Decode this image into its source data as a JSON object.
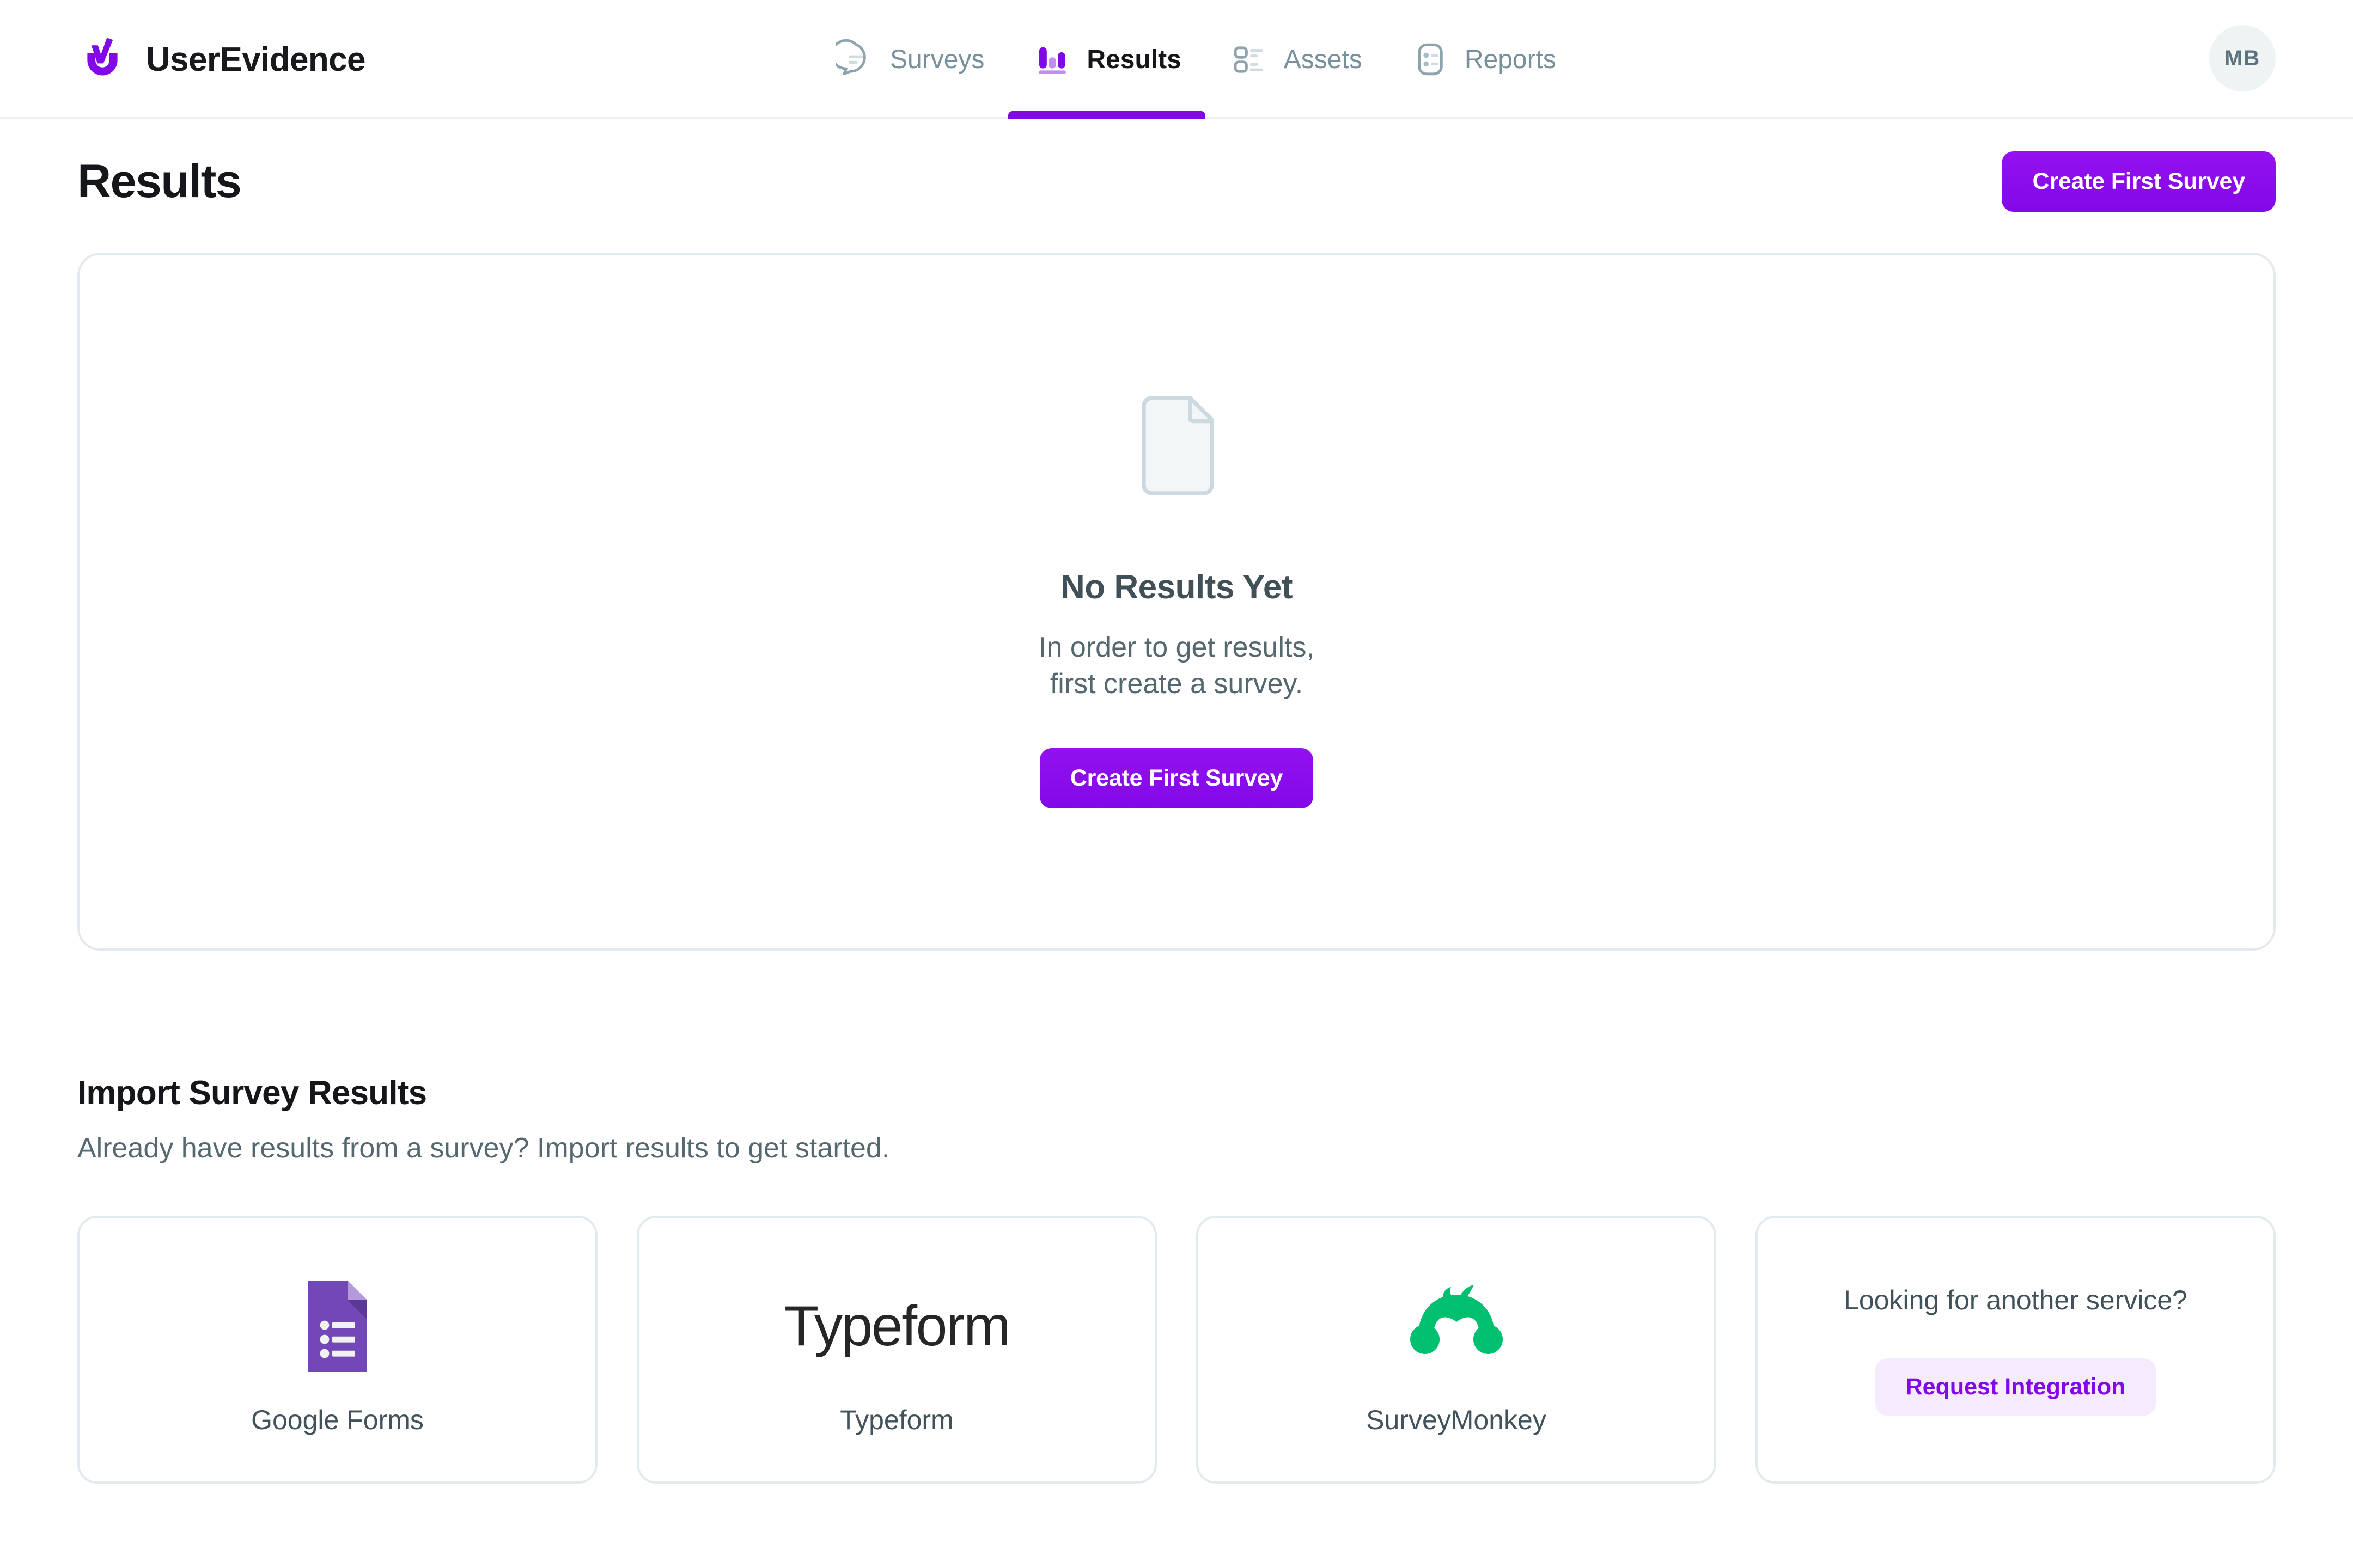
{
  "brand": {
    "name": "UserEvidence",
    "logo_icon": "userevidence-checkmark-logo",
    "accent_color": "#8208e8"
  },
  "nav": {
    "items": [
      {
        "label": "Surveys",
        "icon": "speech-bubble-icon",
        "active": false
      },
      {
        "label": "Results",
        "icon": "bar-chart-icon",
        "active": true
      },
      {
        "label": "Assets",
        "icon": "list-checklist-icon",
        "active": false
      },
      {
        "label": "Reports",
        "icon": "report-card-icon",
        "active": false
      }
    ],
    "inactive_color": "#78909c",
    "active_color": "#14161a"
  },
  "account": {
    "avatar_initials": "MB"
  },
  "page": {
    "title": "Results",
    "header_action_label": "Create First Survey"
  },
  "empty_state": {
    "icon": "document-page-icon",
    "title": "No Results Yet",
    "line1": "In order to get results,",
    "line2": "first create a survey.",
    "cta_label": "Create First Survey"
  },
  "import": {
    "title": "Import Survey Results",
    "subtitle": "Already have results from a survey? Import results to get started.",
    "cards": [
      {
        "label": "Google Forms",
        "icon": "google-forms-icon",
        "color": "#7248b9"
      },
      {
        "label": "Typeform",
        "icon": "typeform-wordmark",
        "wordmark": "Typeform",
        "color": "#262627"
      },
      {
        "label": "SurveyMonkey",
        "icon": "surveymonkey-monkey-icon",
        "color": "#00bf6f"
      }
    ],
    "other": {
      "question": "Looking for another service?",
      "button_label": "Request Integration",
      "button_bg": "#f6eafd",
      "button_text_color": "#8208e8"
    }
  }
}
